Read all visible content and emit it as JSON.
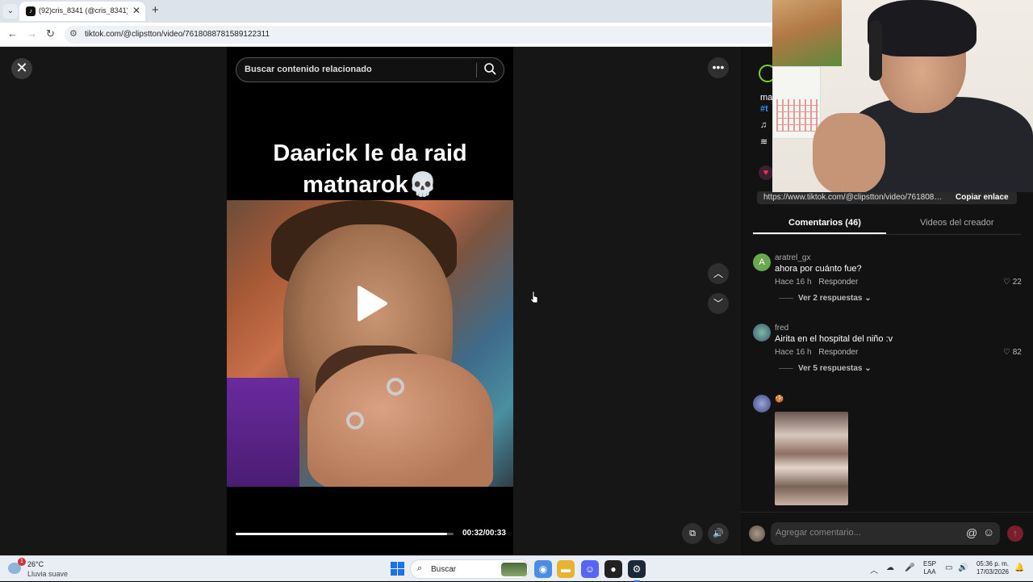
{
  "browser": {
    "tab_title": "(92)cris_8341 (@cris_8341) | Tik",
    "tab_close": "✕",
    "new_tab": "+",
    "url": "tiktok.com/@clipstton/video/7618088781589122311"
  },
  "video": {
    "search_placeholder": "Buscar contenido relacionado",
    "caption_line1": "Daarick le da raid",
    "caption_line2": "matnarok💀",
    "current_time": "00:32",
    "duration": "00:33",
    "time_label": "00:32/00:33",
    "progress_fraction": 0.97
  },
  "panel": {
    "frag_title": "ma",
    "frag_tag": "#t",
    "frag_music": "♫",
    "frag_effect": "≋",
    "link": "https://www.tiktok.com/@clipstton/video/7618088...",
    "copy_link": "Copiar enlace",
    "tab_comments": "Comentarios (46)",
    "tab_creator_videos": "Videos del creador",
    "comments": [
      {
        "avatar_letter": "A",
        "user": "aratrel_gx",
        "text": "ahora por cuánto fue?",
        "time": "Hace 16 h",
        "reply": "Responder",
        "likes": "22",
        "replies": "Ver 2 respuestas"
      },
      {
        "user": "fred",
        "text": "Airita en el hospital del niño :v",
        "time": "Hace 16 h",
        "reply": "Responder",
        "likes": "82",
        "replies": "Ver 5 respuestas"
      },
      {
        "user": "🍪"
      }
    ],
    "compose_placeholder": "Agregar comentario...",
    "at_symbol": "@",
    "emoji_symbol": "☺"
  },
  "taskbar": {
    "badge": "1",
    "temperature": "26°C",
    "condition": "Lluvia suave",
    "search_label": "Buscar",
    "lang_top": "ESP",
    "lang_bottom": "LAA",
    "time": "05:36 p. m.",
    "date": "17/03/2026"
  },
  "colors": {
    "accent_pink": "#fe2c55",
    "hashtag_blue": "#3b8cf0",
    "comment_avatar_green": "#6aa84f"
  },
  "icons": [
    "tab-list-icon",
    "tiktok-favicon-icon",
    "back-icon",
    "forward-icon",
    "reload-icon",
    "site-info-icon",
    "close-icon",
    "search-icon",
    "play-icon",
    "more-icon",
    "chevron-up-icon",
    "chevron-down-icon",
    "pip-icon",
    "volume-icon",
    "heart-icon",
    "send-icon",
    "weather-icon",
    "windows-start-icon"
  ]
}
